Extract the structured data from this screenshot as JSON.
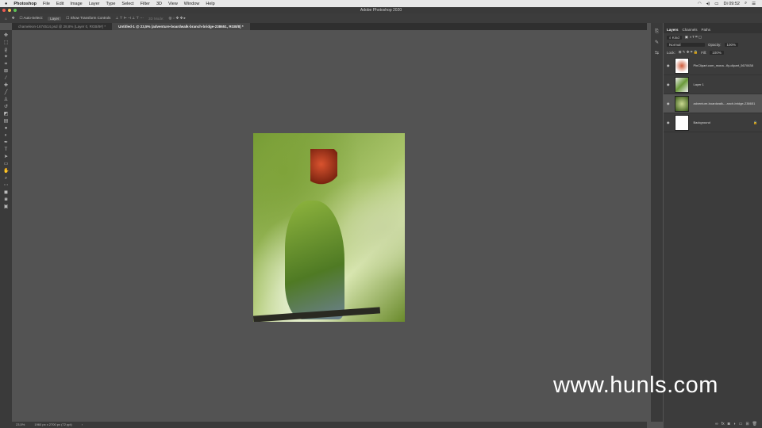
{
  "menubar": {
    "app": "Photoshop",
    "items": [
      "File",
      "Edit",
      "Image",
      "Layer",
      "Type",
      "Select",
      "Filter",
      "3D",
      "View",
      "Window",
      "Help"
    ],
    "time": "Di 09:52"
  },
  "window_title": "Adobe Photoshop 2020",
  "options": {
    "auto_select": "Auto-Select:",
    "target": "Layer",
    "show_transform": "Show Transform Controls",
    "mode_3d": "3D Mode:"
  },
  "tabs": [
    {
      "label": "chameleon-1674514.psd @ 28,8% (Layer 0, RGB/8#) *"
    },
    {
      "label": "Untitled-1 @ 23,5% (adventure-boardwalk-branch-bridge-238651, RGB/8) *"
    }
  ],
  "panel": {
    "tabs": [
      "Layers",
      "Channels",
      "Paths"
    ],
    "filter": "Kind",
    "blend": "Normal",
    "opacity_label": "Opacity:",
    "opacity": "100%",
    "lock_label": "Lock:",
    "fill_label": "Fill:",
    "fill": "100%",
    "layers": [
      {
        "name": "PinClipart.com_mona...fly-clipart_5670638"
      },
      {
        "name": "Layer 1"
      },
      {
        "name": "adventure-boardwalk-...anch-bridge-238651"
      },
      {
        "name": "Background"
      }
    ]
  },
  "status": {
    "zoom": "23,5%",
    "doc": "1960 px x 2700 px (72 ppi)"
  },
  "watermark": "www.hunls.com"
}
